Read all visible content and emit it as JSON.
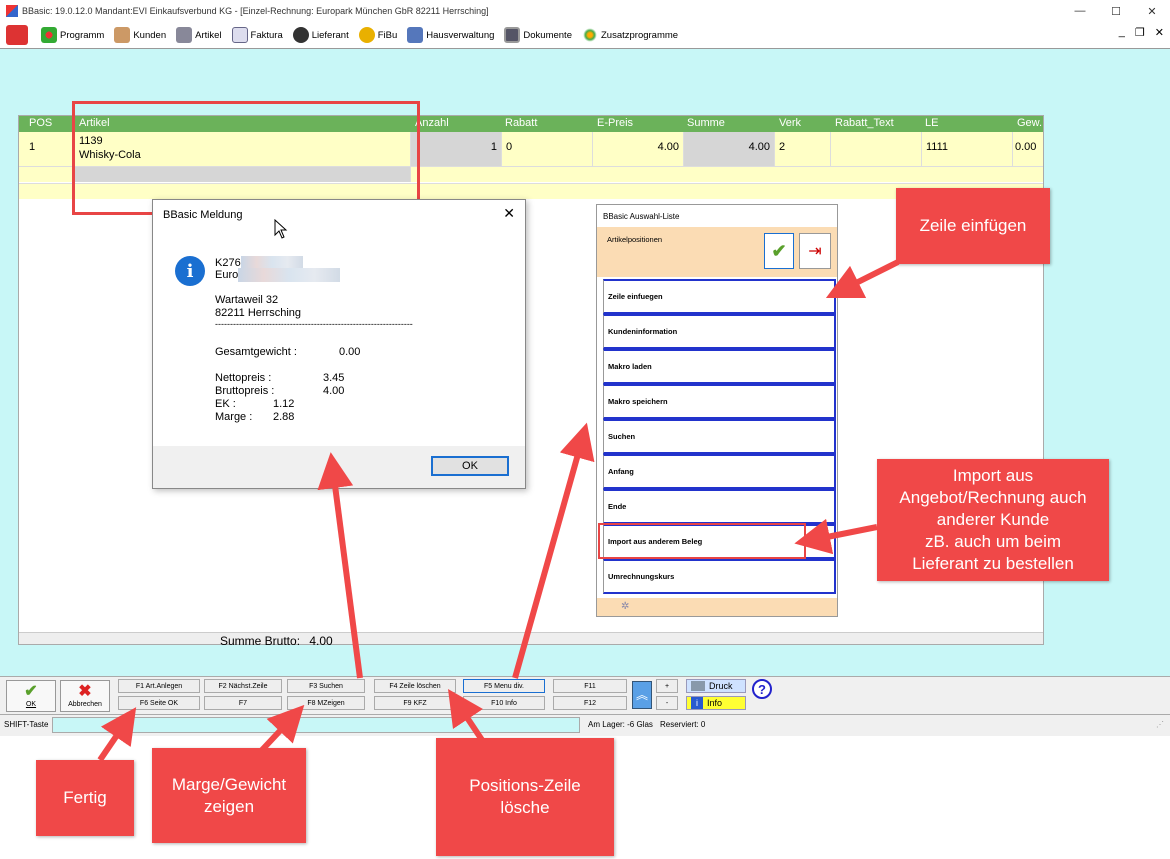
{
  "window": {
    "title": "BBasic: 19.0.12.0 Mandant:EVI Einkaufsverbund KG  - [Einzel-Rechnung: Europark München GbR 82211 Herrsching]"
  },
  "menu": {
    "items": [
      "Programm",
      "Kunden",
      "Artikel",
      "Faktura",
      "Lieferant",
      "FiBu",
      "Hausverwaltung",
      "Dokumente",
      "Zusatzprogramme"
    ]
  },
  "grid": {
    "columns": [
      "POS",
      "Artikel",
      "Anzahl",
      "Rabatt",
      "E-Preis",
      "Summe",
      "Verk",
      "Rabatt_Text",
      "LE",
      "Gew."
    ],
    "rows": [
      {
        "pos": "1",
        "artikel_nr": "1139",
        "artikel_name": "Whisky-Cola",
        "anzahl": "1",
        "rabatt": "0",
        "epreis": "4.00",
        "summe": "4.00",
        "verk": "2",
        "rabatt_text": "",
        "le": "1111",
        "gew": "0.00"
      }
    ]
  },
  "summe_brutto": {
    "label": "Summe Brutto:",
    "value": "4.00"
  },
  "dialog": {
    "title": "BBasic Meldung",
    "line1": "K276",
    "line2": "Euro",
    "street": "Wartaweil 32",
    "city": "82211 Herrsching",
    "divider": "------------------------------------------------------------------",
    "gesamtgewicht_label": "Gesamtgewicht :",
    "gesamtgewicht": "0.00",
    "netto_label": "Nettopreis :",
    "netto": "3.45",
    "brutto_label": "Bruttopreis :",
    "brutto": "4.00",
    "ek_label": "EK :",
    "ek": "1.12",
    "marge_label": "Marge :",
    "marge": "2.88",
    "ok": "OK"
  },
  "auswahl": {
    "title": "BBasic Auswahl-Liste",
    "header_label": "Artikelpositionen",
    "items": [
      "Zeile einfuegen",
      "Kundeninformation",
      "Makro laden",
      "Makro speichern",
      "Suchen",
      "Anfang",
      "Ende",
      "Import aus anderem Beleg",
      "Umrechnungskurs"
    ]
  },
  "toolbar": {
    "ok": "OK",
    "abbrechen": "Abbrechen",
    "f_row1": [
      "F1 Art.Anlegen",
      "F2 Nächst.Zeile",
      "F3 Suchen",
      "F4 Zeile löschen",
      "F5 Menu div.",
      "F11"
    ],
    "f_row2": [
      "F6 Seite OK",
      "F7",
      "F8 MZeigen",
      "F9 KFZ",
      "F10 Info",
      "F12"
    ],
    "plus": "+",
    "minus": "-",
    "druck": "Druck",
    "info": "Info"
  },
  "status": {
    "shift": "SHIFT-Taste",
    "lager": "Am Lager: -6 Glas",
    "reserviert": "Reserviert: 0"
  },
  "callouts": {
    "zeile_einfuegen": "Zeile einfügen",
    "import": [
      "Import aus",
      "Angebot/Rechnung auch",
      "anderer Kunde",
      "zB. auch um beim",
      "Lieferant zu bestellen"
    ],
    "fertig": "Fertig",
    "marge": [
      "Marge/Gewicht",
      "zeigen"
    ],
    "positions": [
      "Positions-Zeile",
      "lösche"
    ]
  },
  "colors": {
    "accent_red": "#f04848",
    "background": "#c8f7f7",
    "header_green": "#6bb25a",
    "row_yellow": "#ffffc6"
  }
}
